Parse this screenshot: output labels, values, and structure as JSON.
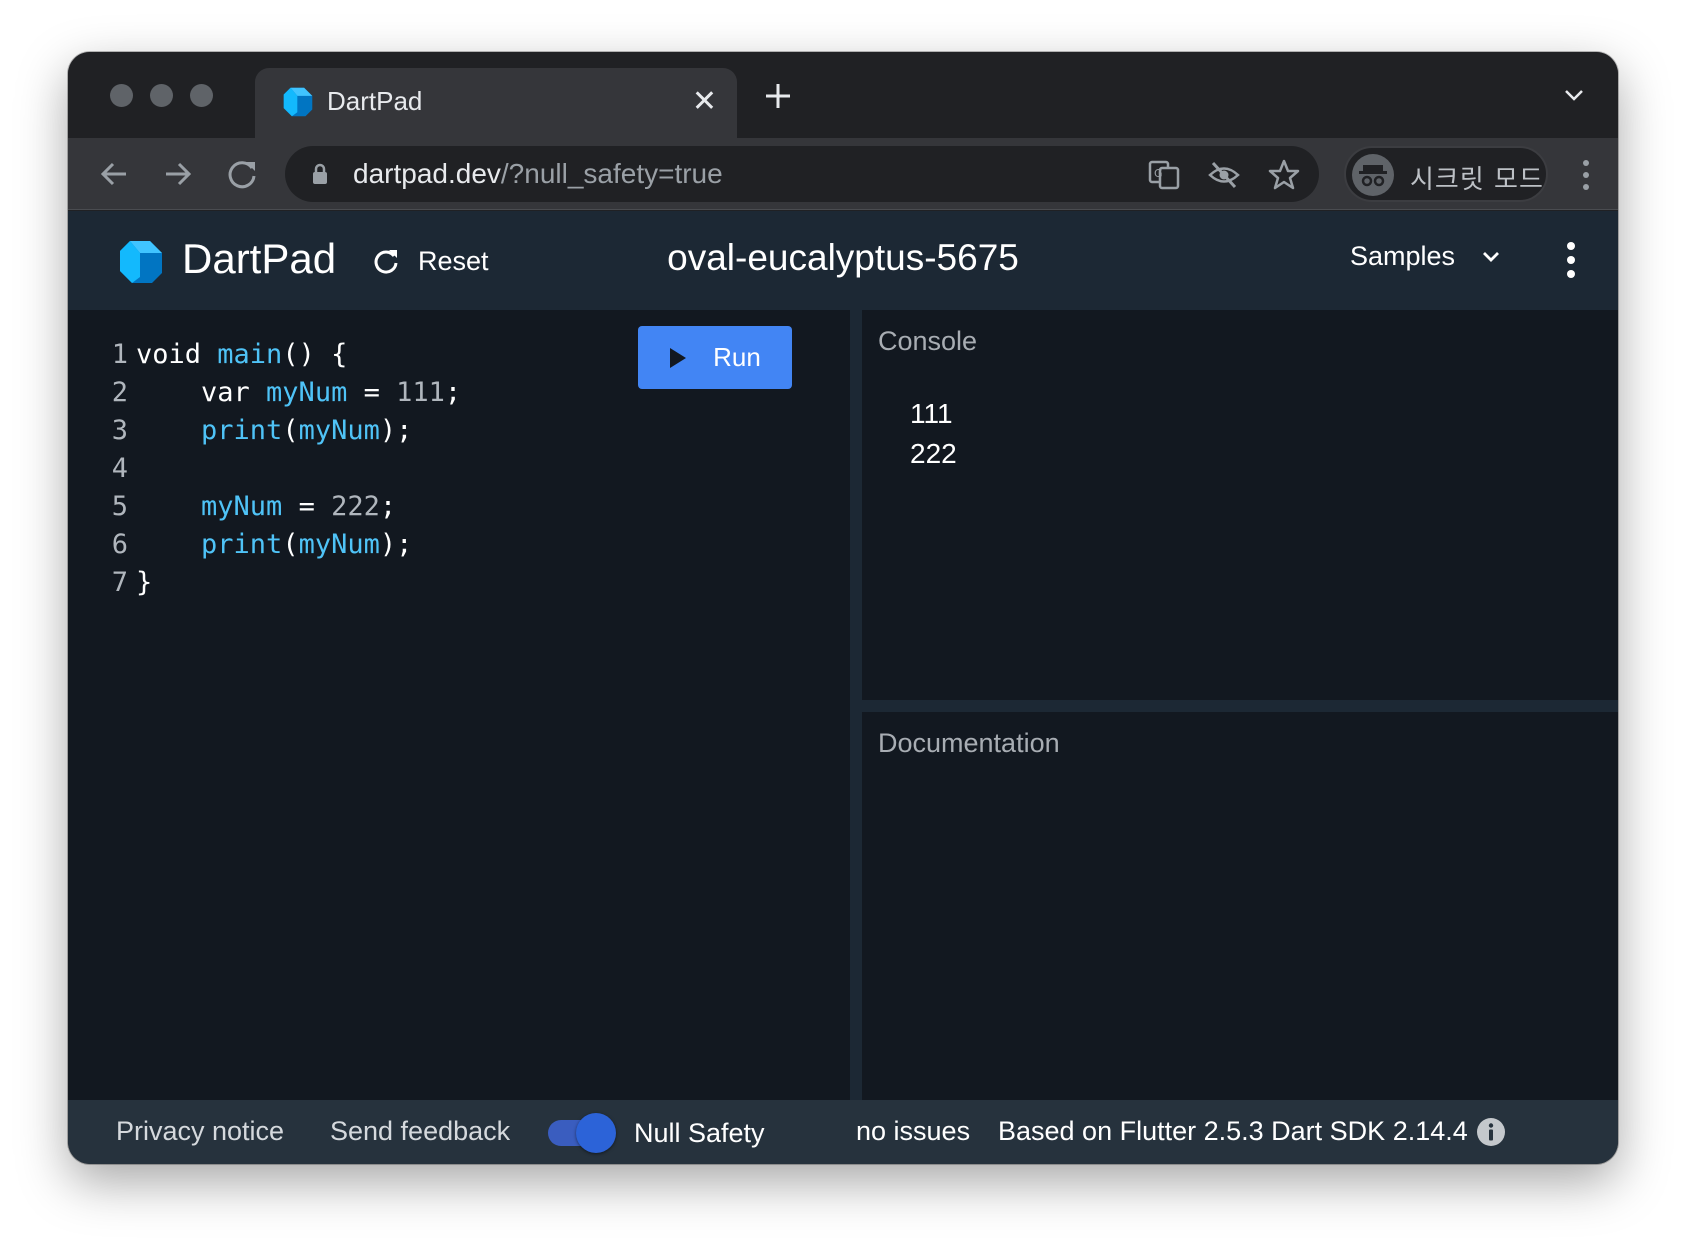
{
  "browser": {
    "tab": {
      "title": "DartPad",
      "close_glyph": "✕"
    },
    "url_host": "dartpad.dev",
    "url_rest": "/?null_safety=true",
    "incognito_label": "시크릿 모드"
  },
  "app": {
    "name": "DartPad",
    "reset_label": "Reset",
    "pad_title": "oval-eucalyptus-5675",
    "samples_label": "Samples",
    "run_label": "Run"
  },
  "editor": {
    "lines": [
      {
        "n": "1",
        "parts": [
          {
            "t": "void ",
            "c": "plain"
          },
          {
            "t": "main",
            "c": "fn"
          },
          {
            "t": "() {",
            "c": "plain"
          }
        ]
      },
      {
        "n": "2",
        "parts": [
          {
            "t": "    var ",
            "c": "plain"
          },
          {
            "t": "myNum",
            "c": "fn"
          },
          {
            "t": " = ",
            "c": "plain"
          },
          {
            "t": "111",
            "c": "num"
          },
          {
            "t": ";",
            "c": "plain"
          }
        ]
      },
      {
        "n": "3",
        "parts": [
          {
            "t": "    ",
            "c": "plain"
          },
          {
            "t": "print",
            "c": "fn"
          },
          {
            "t": "(",
            "c": "plain"
          },
          {
            "t": "myNum",
            "c": "fn"
          },
          {
            "t": ");",
            "c": "plain"
          }
        ]
      },
      {
        "n": "4",
        "parts": []
      },
      {
        "n": "5",
        "parts": [
          {
            "t": "    ",
            "c": "plain"
          },
          {
            "t": "myNum",
            "c": "fn"
          },
          {
            "t": " = ",
            "c": "plain"
          },
          {
            "t": "222",
            "c": "num"
          },
          {
            "t": ";",
            "c": "plain"
          }
        ]
      },
      {
        "n": "6",
        "parts": [
          {
            "t": "    ",
            "c": "plain"
          },
          {
            "t": "print",
            "c": "fn"
          },
          {
            "t": "(",
            "c": "plain"
          },
          {
            "t": "myNum",
            "c": "fn"
          },
          {
            "t": ");",
            "c": "plain"
          }
        ]
      },
      {
        "n": "7",
        "parts": [
          {
            "t": "}",
            "c": "plain"
          }
        ]
      }
    ]
  },
  "console": {
    "title": "Console",
    "output": [
      "111",
      "222"
    ]
  },
  "docs": {
    "title": "Documentation"
  },
  "footer": {
    "privacy": "Privacy notice",
    "feedback": "Send feedback",
    "null_safety": "Null Safety",
    "null_safety_on": true,
    "issues": "no issues",
    "sdk": "Based on Flutter 2.5.3 Dart SDK 2.14.4"
  },
  "colors": {
    "accent": "#4285f4",
    "code_identifier": "#4fc3f7",
    "header_bg": "#1c2834",
    "editor_bg": "#121820"
  },
  "icons": [
    "dart-logo-icon",
    "close-icon",
    "plus-icon",
    "chevron-down-icon",
    "back-arrow-icon",
    "forward-arrow-icon",
    "reload-icon",
    "lock-icon",
    "translate-icon",
    "eye-off-icon",
    "star-icon",
    "incognito-icon",
    "more-vert-icon",
    "refresh-icon",
    "play-icon",
    "info-icon"
  ]
}
